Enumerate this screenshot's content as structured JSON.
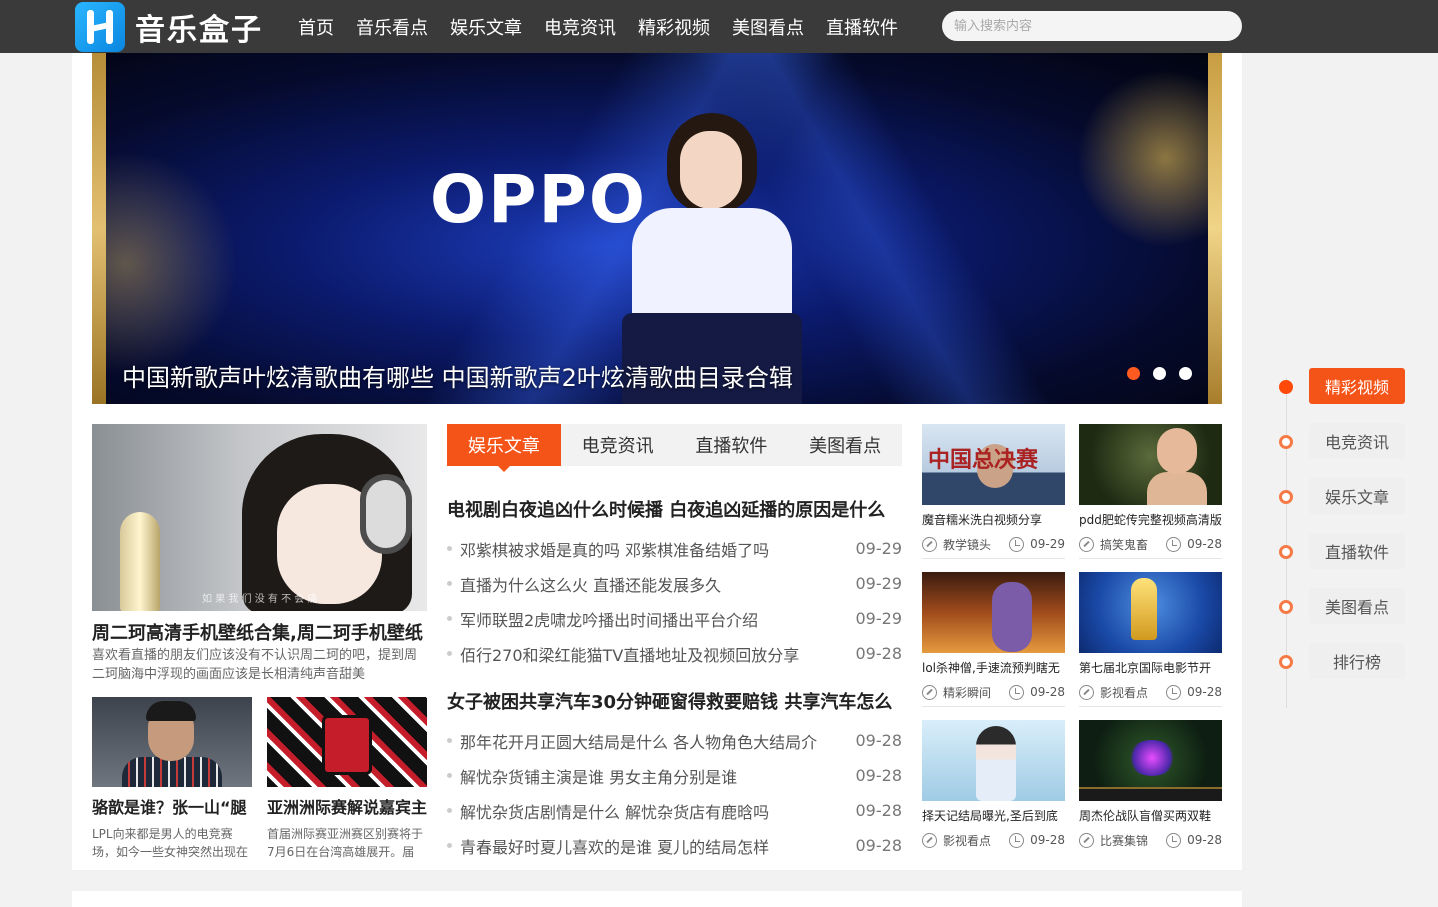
{
  "header": {
    "logo_text": "音乐盒子",
    "nav": [
      "首页",
      "音乐看点",
      "娱乐文章",
      "电竞资讯",
      "精彩视频",
      "美图看点",
      "直播软件"
    ],
    "search_placeholder": "输入搜索内容"
  },
  "banner": {
    "stage_text": "OPPO",
    "caption": "中国新歌声叶炫清歌曲有哪些 中国新歌声2叶炫清歌曲目录合辑",
    "slide_count": 3,
    "active_slide": 1
  },
  "feature": {
    "watermark": "如 果 我 们 没 有 不 会 痛",
    "title": "周二珂高清手机壁纸合集,周二珂手机壁纸",
    "desc": "喜欢看直播的朋友们应该没有不认识周二珂的吧，提到周二珂脑海中浮现的画面应该是长相清纯声音甜美"
  },
  "mini_cards": [
    {
      "title": "骆歆是谁？张一山“腿",
      "desc": "LPL向来都是男人的电竞赛场，如今一些女神突然出现在"
    },
    {
      "title": "亚洲洲际赛解说嘉宾主",
      "desc": "首届洲际赛亚洲赛区别赛将于7月6日在台湾高雄展开。届"
    }
  ],
  "tabs": [
    "娱乐文章",
    "电竞资讯",
    "直播软件",
    "美图看点"
  ],
  "news_group_1": {
    "headline": "电视剧白夜追凶什么时候播 白夜追凶延播的原因是什么",
    "items": [
      {
        "title": "邓紫棋被求婚是真的吗 邓紫棋准备结婚了吗",
        "date": "09-29"
      },
      {
        "title": "直播为什么这么火 直播还能发展多久",
        "date": "09-29"
      },
      {
        "title": "军师联盟2虎啸龙吟播出时间播出平台介绍",
        "date": "09-29"
      },
      {
        "title": "佰行270和梁红能猫TV直播地址及视频回放分享",
        "date": "09-28"
      }
    ]
  },
  "news_group_2": {
    "headline": "女子被困共享汽车30分钟砸窗得救要赔钱 共享汽车怎么",
    "items": [
      {
        "title": "那年花开月正圆大结局是什么 各人物角色大结局介",
        "date": "09-28"
      },
      {
        "title": "解忧杂货铺主演是谁 男女主角分别是谁",
        "date": "09-28"
      },
      {
        "title": "解忧杂货店剧情是什么 解忧杂货店有鹿晗吗",
        "date": "09-28"
      },
      {
        "title": "青春最好时夏儿喜欢的是谁 夏儿的结局怎样",
        "date": "09-28"
      }
    ]
  },
  "grid": [
    {
      "title": "魔音糯米洗白视频分享",
      "category": "教学镜头",
      "date": "09-29",
      "img_text": "中国总决赛"
    },
    {
      "title": "pdd肥蛇传完整视频高清版",
      "category": "搞笑鬼畜",
      "date": "09-28"
    },
    {
      "title": "lol杀神僧,手速流预判瞎无",
      "category": "精彩瞬间",
      "date": "09-28"
    },
    {
      "title": "第七届北京国际电影节开",
      "category": "影视看点",
      "date": "09-28"
    },
    {
      "title": "择天记结局曝光,圣后到底",
      "category": "影视看点",
      "date": "09-28"
    },
    {
      "title": "周杰伦战队盲僧买两双鞋",
      "category": "比赛集锦",
      "date": "09-28"
    }
  ],
  "side_nav": {
    "items": [
      "精彩视频",
      "电竞资讯",
      "娱乐文章",
      "直播软件",
      "美图看点",
      "排行榜"
    ],
    "active_index": 0
  },
  "icons": {
    "category": "edit-icon",
    "time": "clock-icon"
  },
  "colors": {
    "accent": "#f55418",
    "header_bg": "#3a3a3a"
  }
}
